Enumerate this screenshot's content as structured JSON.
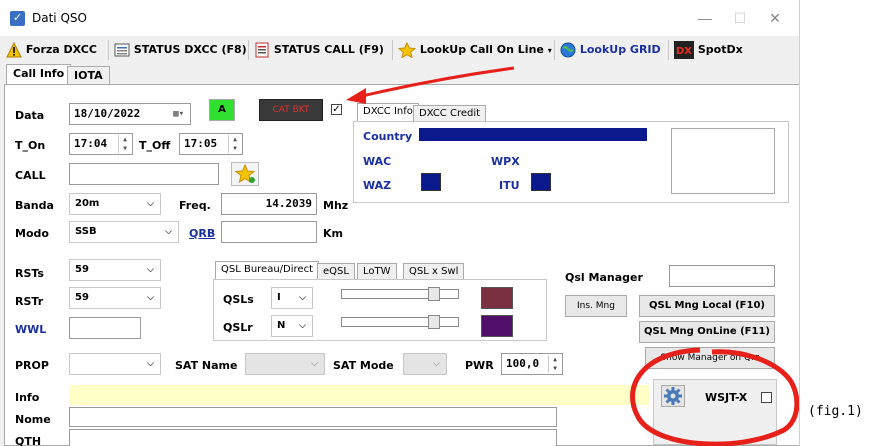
{
  "window": {
    "title": "Dati QSO",
    "controls": {
      "minimize": "—",
      "maximize": "☐",
      "close": "✕"
    }
  },
  "toolbar": {
    "forza": "Forza DXCC",
    "status_dxcc": "STATUS DXCC (F8)",
    "status_call": "STATUS CALL (F9)",
    "lookup_call": "LookUp Call On Line",
    "lookup_grid": "LookUp GRID",
    "spotdx": "SpotDx"
  },
  "tabs": [
    "Call Info",
    "IOTA"
  ],
  "form": {
    "data_label": "Data",
    "data_value": "18/10/2022",
    "a_button": "A",
    "cat_button": "CAT BKT",
    "t_on_label": "T_On",
    "t_on_value": "17:04",
    "t_off_label": "T_Off",
    "t_off_value": "17:05",
    "call_label": "CALL",
    "banda_label": "Banda",
    "banda_value": "20m",
    "freq_label": "Freq.",
    "freq_value": "14.2039",
    "freq_unit": "Mhz",
    "modo_label": "Modo",
    "modo_value": "SSB",
    "qrb_label": "QRB",
    "qrb_unit": "Km",
    "rsts_label": "RSTs",
    "rsts_value": "59",
    "rstr_label": "RSTr",
    "rstr_value": "59",
    "wwl_label": "WWL",
    "prop_label": "PROP",
    "sat_name_label": "SAT Name",
    "sat_mode_label": "SAT Mode",
    "pwr_label": "PWR",
    "pwr_value": "100,0",
    "info_label": "Info",
    "nome_label": "Nome",
    "qth_label": "QTH"
  },
  "dxcc": {
    "tabs": [
      "DXCC Info",
      "DXCC Credit"
    ],
    "country": "Country",
    "wac": "WAC",
    "wpx": "WPX",
    "waz": "WAZ",
    "itu": "ITU"
  },
  "qsl": {
    "tabs": [
      "QSL Bureau/Direct",
      "eQSL",
      "LoTW",
      "QSL x Swl"
    ],
    "qsls_label": "QSLs",
    "qsls_value": "I",
    "qslr_label": "QSLr",
    "qslr_value": "N"
  },
  "manager": {
    "label": "Qsl Manager",
    "ins_mng": "Ins. Mng",
    "local": "QSL Mng Local (F10)",
    "online": "QSL Mng OnLine (F11)",
    "show": "Show Manager on Qrz"
  },
  "wsjt": {
    "label": "WSJT-X"
  },
  "caption": "(fig.1)",
  "colors": {
    "label_blue": "#1a2fa0",
    "navy": "#0a1a8c",
    "info_bg": "#ffffc8",
    "a_green": "#30e030",
    "annotation_red": "#e8201a",
    "swatch_qsls": "#7a3040",
    "swatch_qslr": "#50106a"
  }
}
